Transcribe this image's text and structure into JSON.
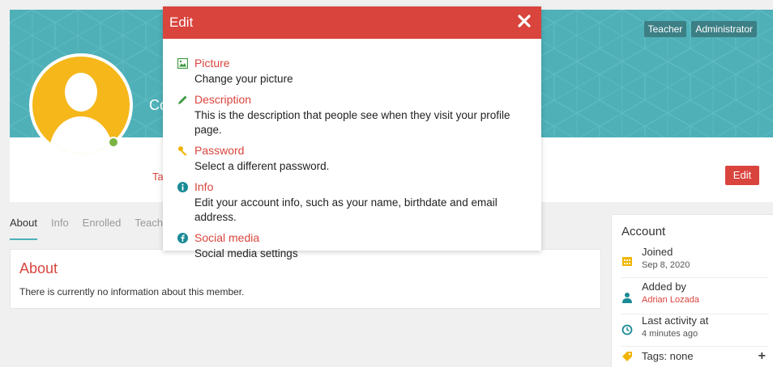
{
  "profile": {
    "roles": [
      "Teacher",
      "Administrator"
    ],
    "name_partial": "Co",
    "tab_partial": "Ta",
    "edit_label": "Edit"
  },
  "tabs": [
    {
      "label": "About",
      "active": true
    },
    {
      "label": "Info",
      "active": false
    },
    {
      "label": "Enrolled",
      "active": false
    },
    {
      "label": "Teach",
      "active": false
    }
  ],
  "about": {
    "title": "About",
    "text": "There is currently no information about this member."
  },
  "account": {
    "title": "Account",
    "joined_label": "Joined",
    "joined_value": "Sep 8, 2020",
    "added_by_label": "Added by",
    "added_by_value": "Adrian Lozada",
    "last_activity_label": "Last activity at",
    "last_activity_value": "4 minutes ago",
    "tags_label": "Tags: none",
    "add_tag_symbol": "+"
  },
  "dialog": {
    "title": "Edit",
    "options": [
      {
        "icon": "picture-icon",
        "label": "Picture",
        "desc": "Change your picture"
      },
      {
        "icon": "pencil-icon",
        "label": "Description",
        "desc": "This is the description that people see when they visit your profile page."
      },
      {
        "icon": "key-icon",
        "label": "Password",
        "desc": "Select a different password."
      },
      {
        "icon": "info-icon",
        "label": "Info",
        "desc": "Edit your account info, such as your name, birthdate and email address."
      },
      {
        "icon": "facebook-icon",
        "label": "Social media",
        "desc": "Social media settings"
      }
    ]
  },
  "colors": {
    "accent": "#d9443d",
    "banner": "#4fb0b8",
    "avatar": "#f5b71a",
    "online": "#7cb342"
  }
}
